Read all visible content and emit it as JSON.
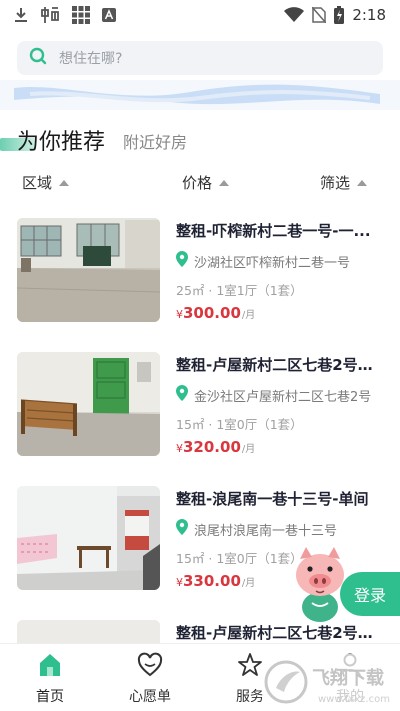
{
  "status_bar": {
    "time": "2:18",
    "icons": [
      "download-icon",
      "app-icon",
      "grid-icon",
      "a-icon",
      "wifi-icon",
      "no-sim-icon",
      "battery-charging-icon"
    ]
  },
  "search": {
    "placeholder": "想住在哪?"
  },
  "section": {
    "title": "为你推荐",
    "subtitle": "附近好房"
  },
  "filters": [
    {
      "label": "区域"
    },
    {
      "label": "价格"
    },
    {
      "label": "筛选"
    }
  ],
  "listings": [
    {
      "title": "整租-吓榨新村二巷一号-一...",
      "location": "沙湖社区吓榨新村二巷一号",
      "meta": "25㎡ · 1室1厅（1套）",
      "currency": "¥",
      "price": "300.00",
      "unit": "/月"
    },
    {
      "title": "整租-卢屋新村二区七巷2号-...",
      "location": "金沙社区卢屋新村二区七巷2号",
      "meta": "15㎡ · 1室0厅（1套）",
      "currency": "¥",
      "price": "320.00",
      "unit": "/月"
    },
    {
      "title": "整租-浪尾南一巷十三号-单间",
      "location": "浪尾村浪尾南一巷十三号",
      "meta": "15㎡ · 1室0厅（1套）",
      "currency": "¥",
      "price": "330.00",
      "unit": "/月"
    },
    {
      "title": "整租-卢屋新村二区七巷2号-...",
      "location": "",
      "meta": "",
      "currency": "",
      "price": "",
      "unit": ""
    }
  ],
  "login": {
    "label": "登录"
  },
  "tabbar": [
    {
      "label": "首页",
      "icon": "home-icon",
      "active_color": "#2fbf8f"
    },
    {
      "label": "心愿单",
      "icon": "heart-icon"
    },
    {
      "label": "服务",
      "icon": "star-icon"
    },
    {
      "label": "我的",
      "icon": "user-icon"
    }
  ],
  "watermark": {
    "text": "飞翔下载",
    "subtext": "www.fxxz.com"
  },
  "colors": {
    "accent": "#2fbf8f",
    "price": "#d9363e"
  }
}
